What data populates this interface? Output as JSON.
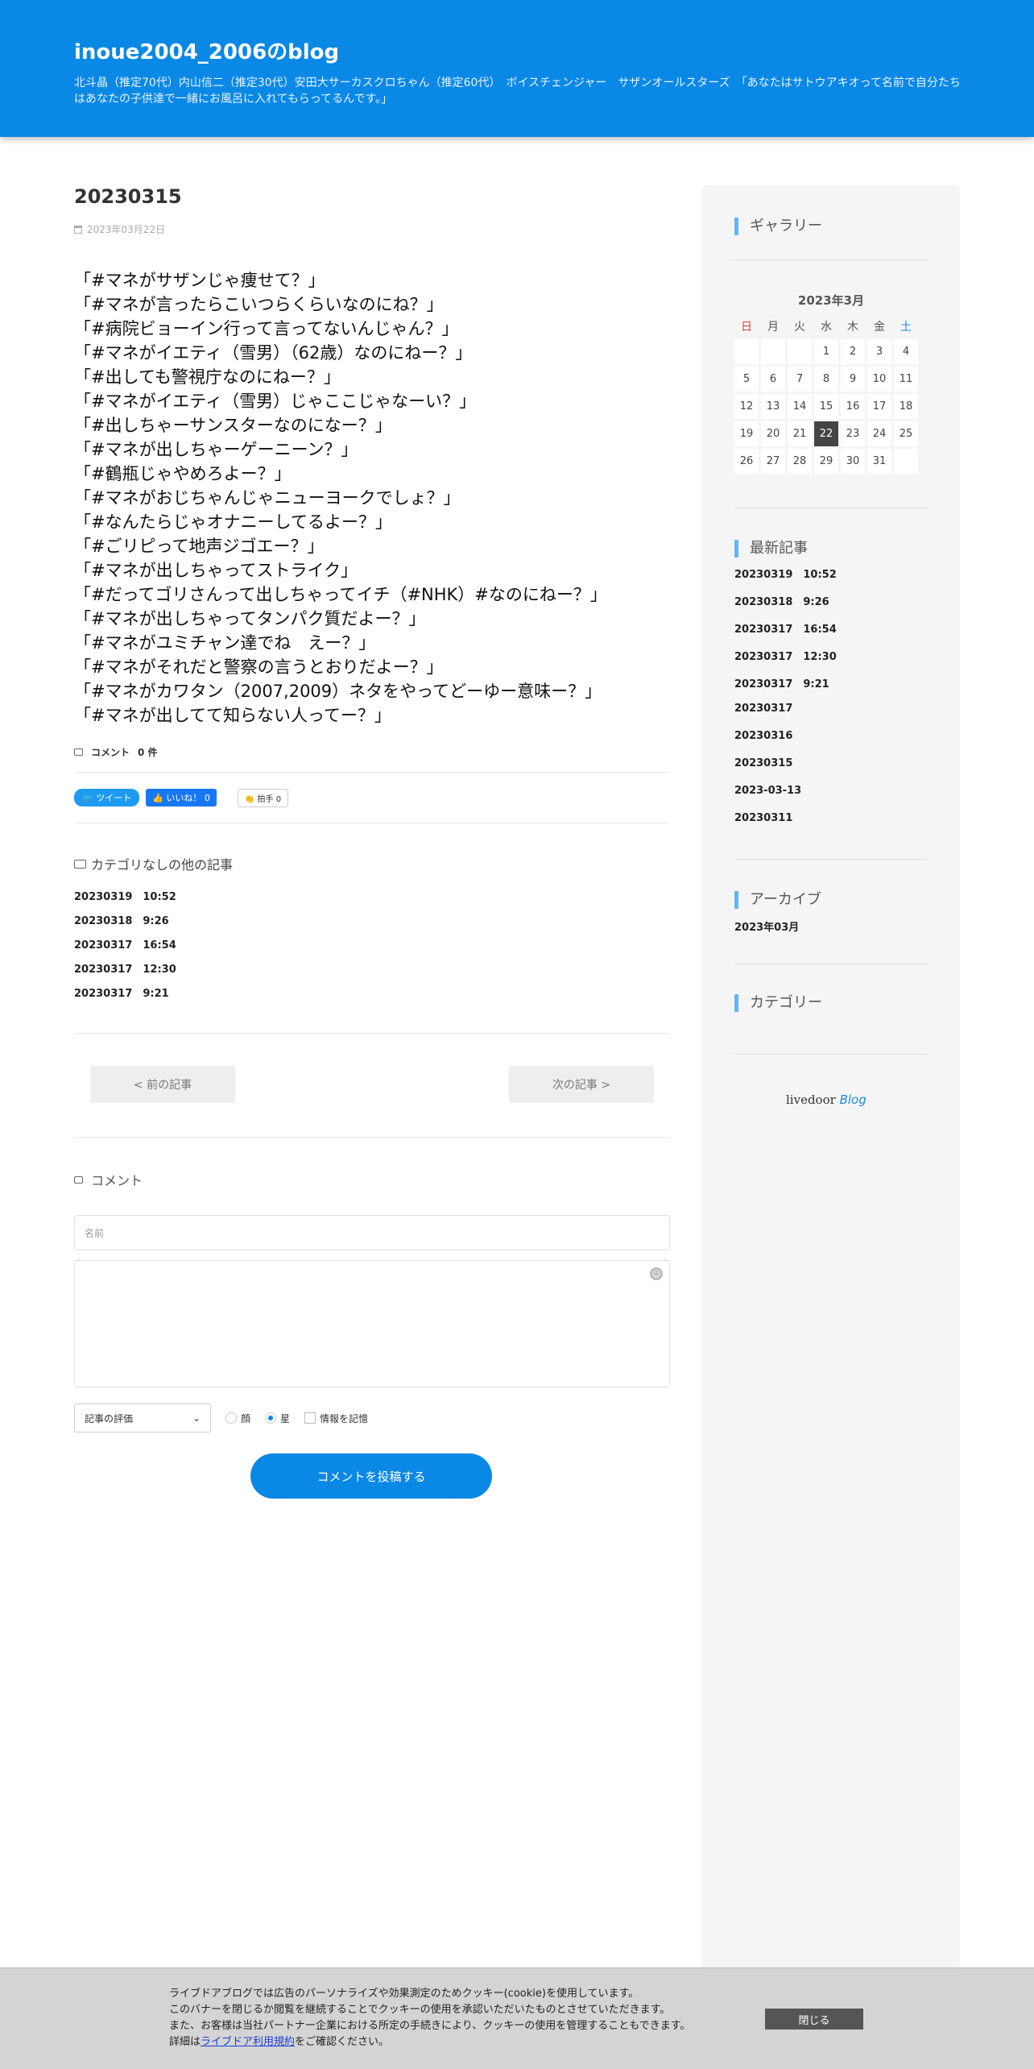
{
  "header": {
    "title": "inoue2004_2006のblog",
    "description": "北斗晶（推定70代）内山信二（推定30代）安田大サーカスクロちゃん（推定60代）　ボイスチェンジャー　サザンオールスターズ　「あなたはサトウアキオって名前で自分たちはあなたの子供達で一緒にお風呂に入れてもらってるんです。」"
  },
  "post": {
    "title": "20230315",
    "date": "2023年03月22日",
    "lines": [
      "「#マネがサザンじゃ痩せて？」",
      "「#マネが言ったらこいつらくらいなのにね？」",
      "「#病院ビョーイン行って言ってないんじゃん？」",
      "「#マネがイエティ（雪男）（62歳）なのにねー？」",
      "「#出しても警視庁なのにねー？」",
      "「#マネがイエティ（雪男）じゃここじゃなーい？」",
      "「#出しちゃーサンスターなのになー？」",
      "「#マネが出しちゃーゲーニーン？」",
      "「#鶴瓶じゃやめろよー？」",
      "「#マネがおじちゃんじゃニューヨークでしょ？」",
      "「#なんたらじゃオナニーしてるよー？」",
      "「#ごリピって地声ジゴエー？」",
      "「#マネが出しちゃってストライク」",
      "「#だってゴリさんって出しちゃってイチ（#NHK）#なのにねー？」",
      "「#マネが出しちゃってタンパク質だよー？」",
      "「#マネがユミチャン達でね　えー？」",
      "「#マネがそれだと警察の言うとおりだよー？」",
      "「#マネがカワタン（2007,2009）ネタをやってどーゆー意味ー？」",
      "「#マネが出してて知らない人ってー？」"
    ],
    "comment_label": "コメント",
    "comment_count": "0 件"
  },
  "share": {
    "tweet": "ツイート",
    "like": "いいね！ 0",
    "clap": "拍手 0"
  },
  "other": {
    "title": "カテゴリなしの他の記事",
    "items": [
      "20230319　10:52",
      "20230318　9:26",
      "20230317　16:54",
      "20230317　12:30",
      "20230317　9:21"
    ]
  },
  "pager": {
    "prev": "< 前の記事",
    "next": "次の記事 >"
  },
  "comment_form": {
    "title": "コメント",
    "name_placeholder": "名前",
    "rating": "記事の評価",
    "radio_face": "顔",
    "radio_star": "星",
    "remember": "情報を記憶",
    "submit": "コメントを投稿する"
  },
  "sidebar": {
    "gallery": "ギャラリー",
    "calendar": {
      "caption": "2023年3月",
      "weekdays": [
        "日",
        "月",
        "火",
        "水",
        "木",
        "金",
        "土"
      ],
      "weeks": [
        [
          "",
          "",
          "",
          "1",
          "2",
          "3",
          "4"
        ],
        [
          "5",
          "6",
          "7",
          "8",
          "9",
          "10",
          "11"
        ],
        [
          "12",
          "13",
          "14",
          "15",
          "16",
          "17",
          "18"
        ],
        [
          "19",
          "20",
          "21",
          "22",
          "23",
          "24",
          "25"
        ],
        [
          "26",
          "27",
          "28",
          "29",
          "30",
          "31",
          ""
        ]
      ],
      "today": "22"
    },
    "recent_title": "最新記事",
    "recent": [
      "20230319　10:52",
      "20230318　9:26",
      "20230317　16:54",
      "20230317　12:30",
      "20230317　9:21",
      "20230317",
      "20230316",
      "20230315",
      "2023-03-13",
      "20230311"
    ],
    "archive_title": "アーカイブ",
    "archive": "2023年03月",
    "category_title": "カテゴリー",
    "logo_text": "livedoor",
    "logo_blog": "Blog"
  },
  "cookie": {
    "line1": "ライブドアブログでは広告のパーソナライズや効果測定のためクッキー(cookie)を使用しています。",
    "line2": "このバナーを閉じるか閲覧を継続することでクッキーの使用を承認いただいたものとさせていただきます。",
    "line3": "また、お客様は当社パートナー企業における所定の手続きにより、クッキーの使用を管理することもできます。",
    "line4_pre": "詳細は",
    "line4_link": "ライブドア利用規約",
    "line4_post": "をご確認ください。",
    "close": "閉じる"
  }
}
